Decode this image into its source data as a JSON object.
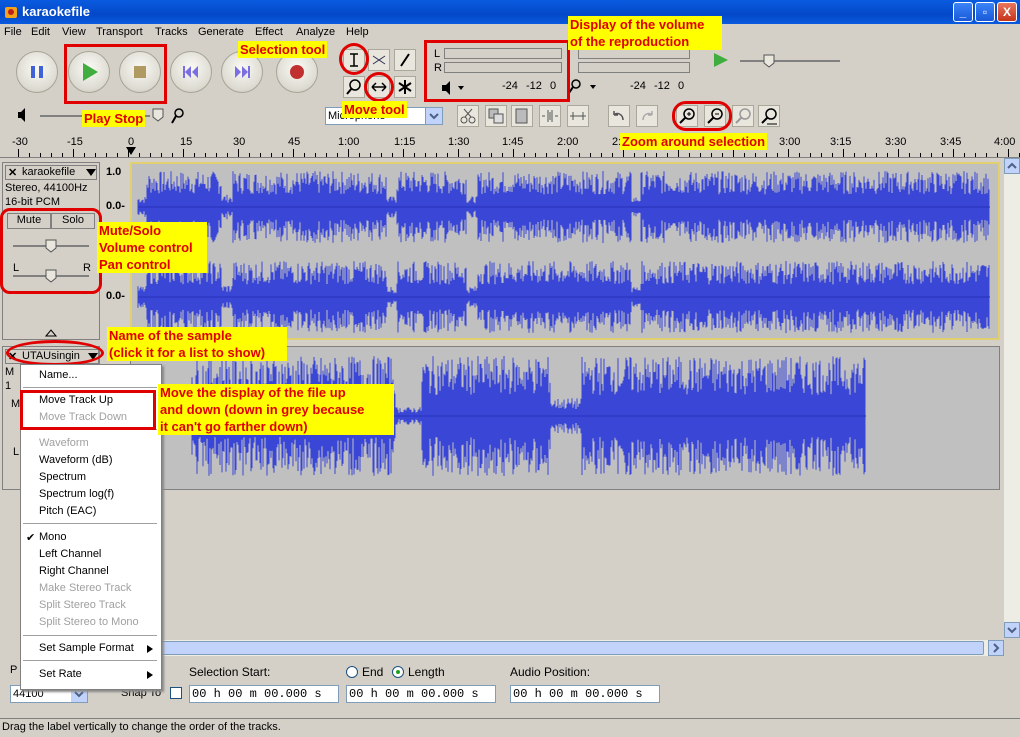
{
  "window": {
    "title": "karaokefile",
    "minimize": "_",
    "maximize": "▫",
    "close": "X"
  },
  "menu": [
    "File",
    "Edit",
    "View",
    "Transport",
    "Tracks",
    "Generate",
    "Effect",
    "Analyze",
    "Help"
  ],
  "meters": {
    "play_L": "L",
    "play_R": "R",
    "scale": [
      "-24",
      "-12",
      "0"
    ],
    "rec_scale": [
      "-24",
      "-12",
      "0"
    ]
  },
  "mixer": {
    "input_source": "Microphone"
  },
  "ruler": {
    "ticks": [
      "-30",
      "-15",
      "0",
      "15",
      "30",
      "45",
      "1:00",
      "1:15",
      "1:30",
      "1:45",
      "2:00",
      "2:",
      "",
      "3:00",
      "3:15",
      "3:30",
      "3:45",
      "4:00"
    ]
  },
  "track1": {
    "name": "karaokefile",
    "info_line1": "Stereo, 44100Hz",
    "info_line2": "16-bit PCM",
    "mute": "Mute",
    "solo": "Solo",
    "pan_left": "L",
    "pan_right": "R",
    "scale_top": "1.0",
    "scale_mid1": "0.0-",
    "scale_mid2": "0.0-"
  },
  "track2": {
    "name": "UTAUsingin",
    "info_partial1": "M",
    "info_partial2": "1",
    "mute_partial": "M",
    "pan_left_partial": "L"
  },
  "popup": {
    "items": [
      {
        "label": "Name...",
        "disabled": false
      },
      {
        "label": "Move Track Up",
        "disabled": false
      },
      {
        "label": "Move Track Down",
        "disabled": true
      },
      {
        "label": "Waveform",
        "disabled": true
      },
      {
        "label": "Waveform (dB)",
        "disabled": false
      },
      {
        "label": "Spectrum",
        "disabled": false
      },
      {
        "label": "Spectrum log(f)",
        "disabled": false
      },
      {
        "label": "Pitch (EAC)",
        "disabled": false
      },
      {
        "label": "Mono",
        "disabled": false,
        "checked": true
      },
      {
        "label": "Left Channel",
        "disabled": false
      },
      {
        "label": "Right Channel",
        "disabled": false
      },
      {
        "label": "Make Stereo Track",
        "disabled": true
      },
      {
        "label": "Split Stereo Track",
        "disabled": true
      },
      {
        "label": "Split Stereo to Mono",
        "disabled": true
      },
      {
        "label": "Set Sample Format",
        "disabled": false,
        "submenu": true
      },
      {
        "label": "Set Rate",
        "disabled": false,
        "submenu": true
      }
    ],
    "check_mark": "✔"
  },
  "annotations": {
    "selection_tool": "Selection tool",
    "play_stop": "Play Stop",
    "move_tool": "Move tool",
    "display_volume_line1": "Display of the volume",
    "display_volume_line2": "of the reproduction",
    "zoom_selection": "Zoom around selection",
    "mute_solo_line1": "Mute/Solo",
    "mute_solo_line2": "Volume control",
    "mute_solo_line3": "Pan control",
    "name_sample_line1": "Name of the sample",
    "name_sample_line2": "(click it for a list to show)",
    "move_display_line1": "Move the display of the file up",
    "move_display_line2": "and down (down in grey because",
    "move_display_line3": "it can't go farther down)"
  },
  "selection_bar": {
    "project_rate_partial": "P",
    "project_rate": "44100",
    "snap_to": "Snap To",
    "selection_start_label": "Selection Start:",
    "end_label": "End",
    "length_label": "Length",
    "audio_position_label": "Audio Position:",
    "time_value": "00 h 00 m 00.000 s"
  },
  "status": {
    "text": "Drag the label vertically to change the order of the tracks."
  },
  "colors": {
    "wave": "#3a47d6",
    "wave_dark": "#2630b8",
    "annotation_red": "#e00000",
    "annotation_yellow": "#ffff00",
    "titlebar_blue": "#0a5be0"
  }
}
